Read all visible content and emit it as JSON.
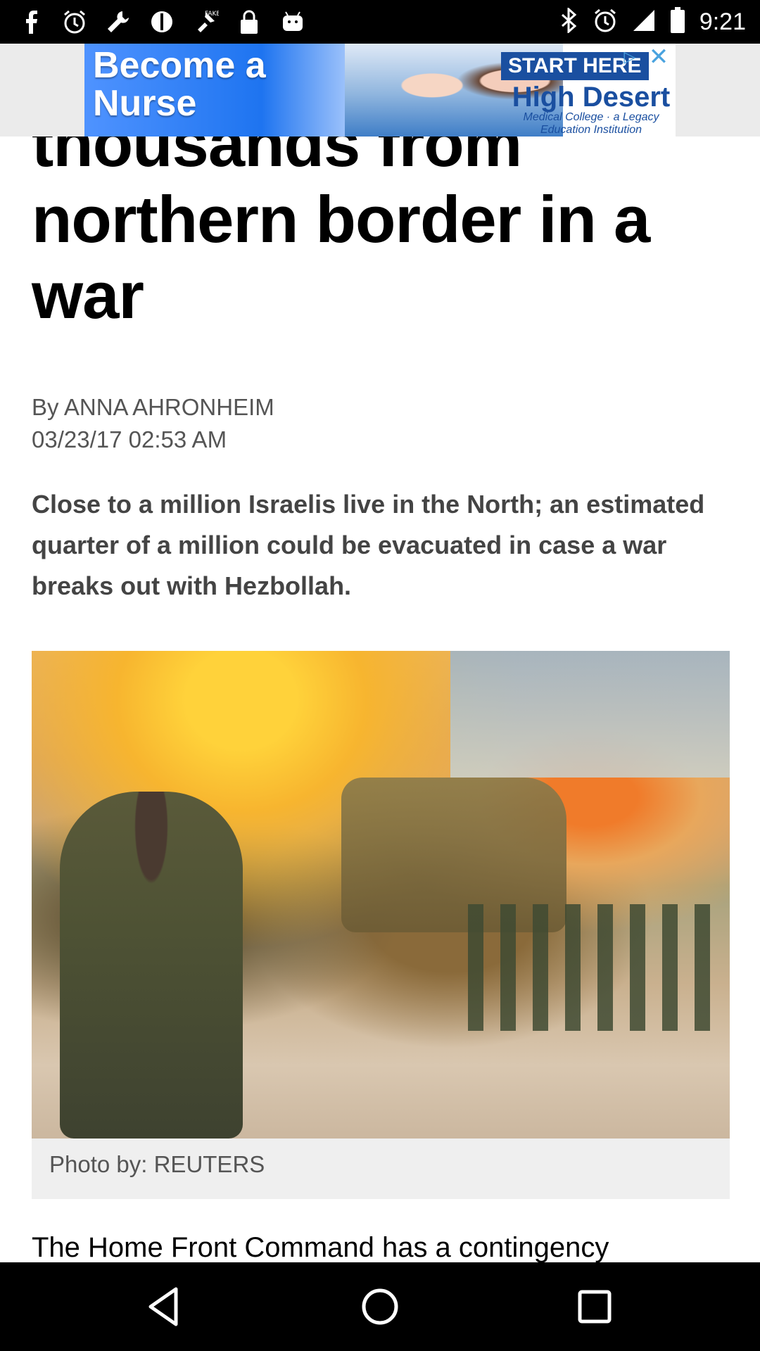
{
  "status_bar": {
    "time": "9:21",
    "left_icons": [
      "facebook-icon",
      "alarm-icon",
      "wrench-icon",
      "circle-slash-icon",
      "fake-gps-icon",
      "lock-icon",
      "android-icon"
    ],
    "right_icons": [
      "bluetooth-icon",
      "alarm-icon",
      "signal-icon",
      "battery-icon"
    ]
  },
  "ad": {
    "headline": "Become a Nurse",
    "cta": "START HERE",
    "brand": "High Desert",
    "brand_sub": "Medical College",
    "tagline": "a Legacy Education Institution"
  },
  "article": {
    "headline": "thousands from northern border in a war",
    "byline": "By ANNA AHRONHEIM",
    "date": "03/23/17 02:53 AM",
    "summary": "Close to a million Israelis live in the North; an estimated quarter of a million could be evacuated in case a war breaks out with Hezbollah.",
    "photo_caption": "Photo by: REUTERS",
    "body_start": "The Home Front Command has a contingency"
  },
  "nav_bar": {
    "buttons": [
      "back-icon",
      "home-icon",
      "recents-icon"
    ]
  }
}
